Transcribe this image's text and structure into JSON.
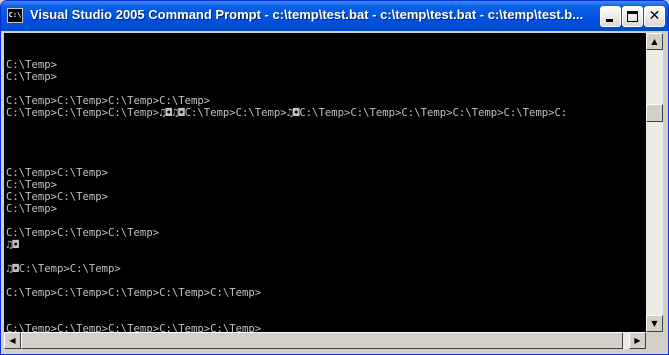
{
  "window": {
    "title": "Visual Studio 2005 Command Prompt - c:\\temp\\test.bat - c:\\temp\\test.bat - c:\\temp\\test.b...",
    "icon_label": "C:\\",
    "buttons": {
      "minimize": "minimize",
      "maximize": "maximize",
      "close": "✕"
    }
  },
  "console": {
    "lines": [
      "",
      "",
      "C:\\Temp>",
      "C:\\Temp>",
      "",
      "C:\\Temp>C:\\Temp>C:\\Temp>C:\\Temp>",
      "C:\\Temp>C:\\Temp>C:\\Temp>♫◘♫◘C:\\Temp>C:\\Temp>♫◘C:\\Temp>C:\\Temp>C:\\Temp>C:\\Temp>C:\\Temp>C:",
      "",
      "",
      "",
      "",
      "C:\\Temp>C:\\Temp>",
      "C:\\Temp>",
      "C:\\Temp>C:\\Temp>",
      "C:\\Temp>",
      "",
      "C:\\Temp>C:\\Temp>C:\\Temp>",
      "♫◘",
      "",
      "♫◘C:\\Temp>C:\\Temp>",
      "",
      "C:\\Temp>C:\\Temp>C:\\Temp>C:\\Temp>C:\\Temp>",
      "",
      "",
      "C:\\Temp>C:\\Temp>C:\\Temp>C:\\Temp>C:\\Temp>"
    ]
  },
  "scrollbars": {
    "vertical": {
      "up": "▲",
      "down": "▼",
      "position": 0.22
    },
    "horizontal": {
      "left": "◀",
      "right": "▶",
      "position": 0.0
    }
  }
}
